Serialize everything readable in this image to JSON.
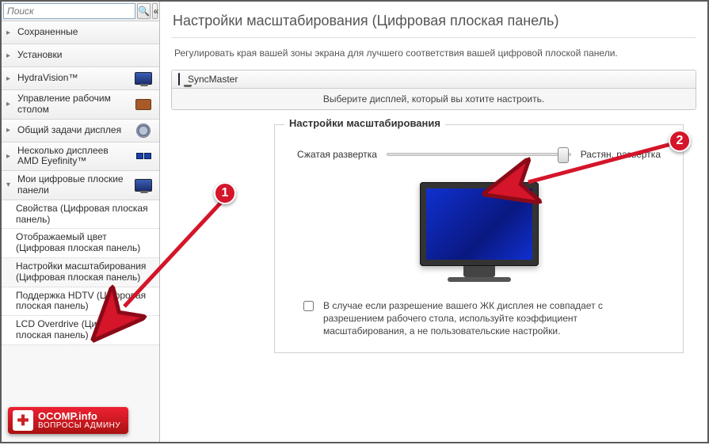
{
  "sidebar": {
    "search_placeholder": "Поиск",
    "items": [
      {
        "label": "Сохраненные",
        "type": "top",
        "chev": "▸",
        "icon": ""
      },
      {
        "label": "Установки",
        "type": "top",
        "chev": "▸",
        "icon": ""
      },
      {
        "label": "HydraVision™",
        "type": "top",
        "chev": "▸",
        "icon": "monitor"
      },
      {
        "label": "Управление рабочим столом",
        "type": "top",
        "chev": "▸",
        "icon": "desk"
      },
      {
        "label": "Общий задачи дисплея",
        "type": "top",
        "chev": "▸",
        "icon": "gear"
      },
      {
        "label": "Несколько дисплеев AMD Eyefinity™",
        "type": "top",
        "chev": "▸",
        "icon": "multi"
      },
      {
        "label": "Мои цифровые плоские панели",
        "type": "top",
        "chev": "▾",
        "icon": "monitor",
        "expanded": true
      },
      {
        "label": "Свойства (Цифровая плоская панель)",
        "type": "sub"
      },
      {
        "label": "Отображаемый цвет (Цифровая плоская панель)",
        "type": "sub"
      },
      {
        "label": "Настройки масштабирования (Цифровая плоская панель)",
        "type": "sub",
        "active": true
      },
      {
        "label": "Поддержка HDTV (Цифровая плоская панель)",
        "type": "sub"
      },
      {
        "label": "LCD Overdrive (Цифровая плоская панель)",
        "type": "sub"
      }
    ]
  },
  "main": {
    "title": "Настройки масштабирования (Цифровая плоская панель)",
    "description": "Регулировать края вашей зоны экрана для лучшего соответствия вашей цифровой плоской панели.",
    "display_name": "SyncMaster",
    "display_pick_hint": "Выберите дисплей, который вы хотите настроить.",
    "scale_panel_title": "Настройки масштабирования",
    "slider_left": "Сжатая развертка",
    "slider_right": "Растян. развертка",
    "checkbox_text": "В случае если разрешение вашего ЖК дисплея не совпадает с разрешением рабочего стола, используйте коэффициент масштабирования, а не пользовательские настройки."
  },
  "annotations": {
    "badge1": "1",
    "badge2": "2"
  },
  "watermark": {
    "line1": "OCOMP.info",
    "line2": "ВОПРОСЫ АДМИНУ"
  }
}
